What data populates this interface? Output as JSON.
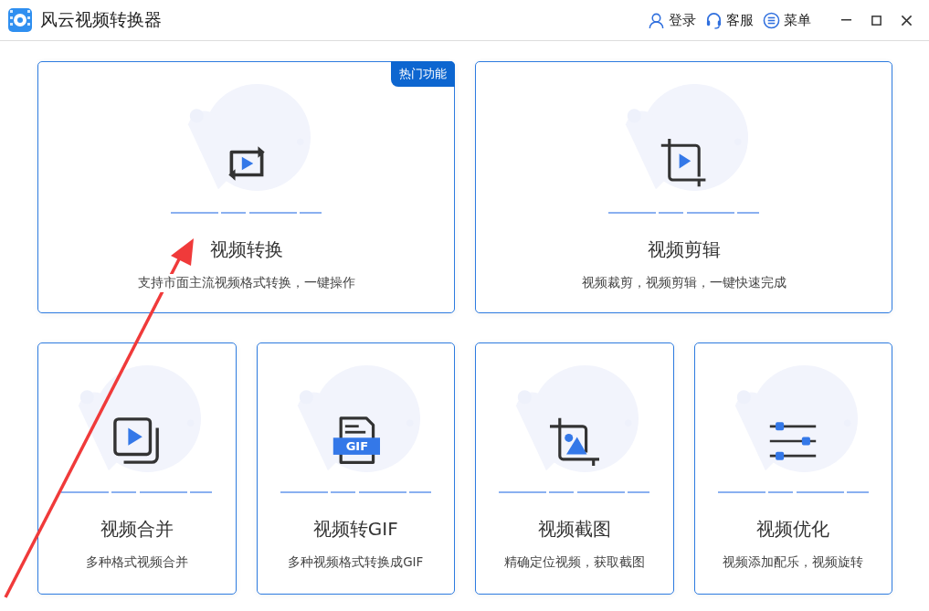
{
  "window": {
    "title": "风云视频转换器"
  },
  "header_actions": [
    {
      "kind": "user",
      "label": "登录"
    },
    {
      "kind": "headset",
      "label": "客服"
    },
    {
      "kind": "menu",
      "label": "菜单"
    }
  ],
  "featured": [
    {
      "kind": "convert",
      "title": "视频转换",
      "description": "支持市面主流视频格式转换，一键操作",
      "badge": "热门功能"
    },
    {
      "kind": "crop-video",
      "title": "视频剪辑",
      "description": "视频裁剪，视频剪辑，一键快速完成"
    }
  ],
  "tools": [
    {
      "kind": "merge",
      "title": "视频合并",
      "description": "多种格式视频合并"
    },
    {
      "kind": "gif",
      "title": "视频转GIF",
      "description": "多种视频格式转换成GIF",
      "icon_text": "GIF"
    },
    {
      "kind": "crop-image",
      "title": "视频截图",
      "description": "精确定位视频，获取截图"
    },
    {
      "kind": "sliders",
      "title": "视频优化",
      "description": "视频添加配乐，视频旋转"
    }
  ]
}
